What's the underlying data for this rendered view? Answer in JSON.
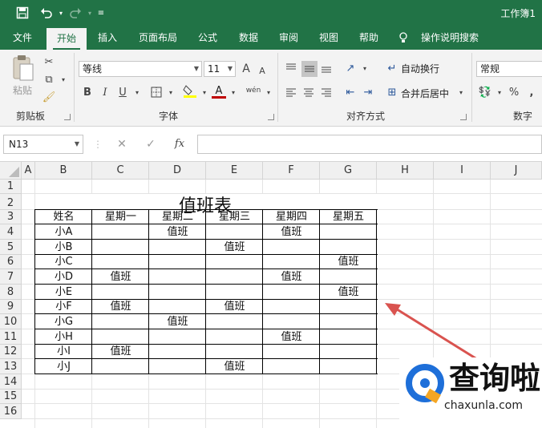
{
  "titlebar": {
    "title": "工作簿1"
  },
  "tabs": [
    "文件",
    "开始",
    "插入",
    "页面布局",
    "公式",
    "数据",
    "审阅",
    "视图",
    "帮助",
    "操作说明搜索"
  ],
  "ribbon": {
    "clipboard": {
      "paste_label": "粘贴",
      "group_label": "剪贴板"
    },
    "font": {
      "name": "等线",
      "size": "11",
      "group_label": "字体",
      "bold": "B",
      "italic": "I",
      "underline": "U",
      "grow": "A",
      "shrink": "A",
      "font_color": "A",
      "phonetic": "wén"
    },
    "alignment": {
      "wrap_text": "自动换行",
      "merge_center": "合并后居中",
      "group_label": "对齐方式"
    },
    "number": {
      "format": "常规",
      "percent": "%",
      "group_label": "数字"
    }
  },
  "formula_bar": {
    "name_box": "N13",
    "fx": "fx",
    "cancel": "✕",
    "enter": "✓",
    "content": ""
  },
  "columns": [
    "A",
    "B",
    "C",
    "D",
    "E",
    "F",
    "G",
    "H",
    "I",
    "J"
  ],
  "rows": [
    "1",
    "2",
    "3",
    "4",
    "5",
    "6",
    "7",
    "8",
    "9",
    "10",
    "11",
    "12",
    "13",
    "14",
    "15",
    "16"
  ],
  "sheet": {
    "title": "值班表",
    "headers": [
      "姓名",
      "星期一",
      "星期二",
      "星期三",
      "星期四",
      "星期五"
    ],
    "data": [
      [
        "小A",
        "",
        "值班",
        "",
        "值班",
        ""
      ],
      [
        "小B",
        "",
        "",
        "值班",
        "",
        ""
      ],
      [
        "小C",
        "",
        "",
        "",
        "",
        "值班"
      ],
      [
        "小D",
        "值班",
        "",
        "",
        "值班",
        ""
      ],
      [
        "小E",
        "",
        "",
        "",
        "",
        "值班"
      ],
      [
        "小F",
        "值班",
        "",
        "值班",
        "",
        ""
      ],
      [
        "小G",
        "",
        "值班",
        "",
        "",
        ""
      ],
      [
        "小H",
        "",
        "",
        "",
        "值班",
        ""
      ],
      [
        "小I",
        "值班",
        "",
        "",
        "",
        ""
      ],
      [
        "小J",
        "",
        "",
        "值班",
        "",
        ""
      ]
    ]
  },
  "watermark": {
    "brand": "查询啦",
    "url": "chaxunla.com"
  },
  "colors": {
    "accent": "#217346",
    "arrow": "#d9534f",
    "watermark_blue": "#1e6fd9",
    "watermark_orange": "#f5a623"
  }
}
